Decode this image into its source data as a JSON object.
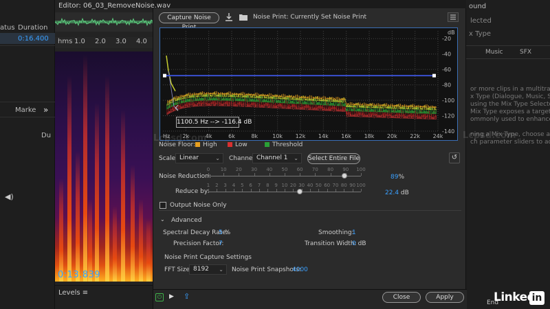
{
  "editor": {
    "title": "Editor: 06_03_RemoveNoise.wav",
    "ruler": [
      "hms",
      "1.0",
      "2.0",
      "3.0",
      "4.0"
    ],
    "time": "0:13.839",
    "levels_label": "Levels"
  },
  "files_panel": {
    "status_col": "atus",
    "duration_col": "Duration",
    "duration_value": "0:16.400",
    "markers_label": "Marke",
    "du_label": "Du"
  },
  "right_panel": {
    "title": "ound",
    "selected": "lected",
    "mix_type": "x Type",
    "tabs": [
      "Music",
      "SFX"
    ],
    "help_text": "or more clips in a multitrack se\nx Type (Dialogue, Music, Soun\nusing the Mix Type Selector al\nMix Type exposes a targeted\nommonly used to enhance that\n\nning a Mix Type, choose a pre\nch parameter sliders to adjust",
    "end_label": "End"
  },
  "dialog": {
    "capture_button": "Capture Noise Print",
    "noise_print_label": "Noise Print: Currently Set Noise Print",
    "cursor_readout": "1100.5 Hz --> -116.4 dB",
    "legend": {
      "title": "Noise Floor:",
      "high": "High",
      "low": "Low",
      "threshold": "Threshold",
      "high_color": "#e8a020",
      "low_color": "#d83030",
      "threshold_color": "#2aa035"
    },
    "scale_label": "Scale:",
    "scale_value": "Linear",
    "channel_label": "Channel:",
    "channel_value": "Channel 1",
    "select_entire_button": "Select Entire File",
    "noise_reduction_label": "Noise Reduction:",
    "noise_reduction_value": "89",
    "noise_reduction_unit": "%",
    "noise_reduction_ticks": [
      "0",
      "10",
      "20",
      "30",
      "40",
      "50",
      "60",
      "70",
      "80",
      "90",
      "100"
    ],
    "noise_reduction_fraction": 0.89,
    "reduce_by_label": "Reduce by:",
    "reduce_by_value": "22.4",
    "reduce_by_unit": "dB",
    "reduce_by_ticks": [
      "1",
      "2",
      "3",
      "4",
      "5",
      "6",
      "7",
      "8",
      "9",
      "10",
      "20",
      "30",
      "40",
      "50",
      "60",
      "70",
      "80",
      "90",
      "100"
    ],
    "reduce_by_fraction": 0.6,
    "output_noise_only": "Output Noise Only",
    "advanced_label": "Advanced",
    "spectral_decay_label": "Spectral Decay Rate:",
    "spectral_decay_value": "5",
    "spectral_decay_unit": "%",
    "smoothing_label": "Smoothing:",
    "smoothing_value": "1",
    "precision_label": "Precision Factor:",
    "precision_value": "7",
    "transition_label": "Transition Width:",
    "transition_value": "0",
    "transition_unit": "dB",
    "capture_settings_label": "Noise Print Capture Settings",
    "fft_label": "FFT Size:",
    "fft_value": "8192",
    "snapshots_label": "Noise Print Snapshots:",
    "snapshots_value": "4000",
    "close_button": "Close",
    "apply_button": "Apply"
  },
  "graph": {
    "db_unit": "dB",
    "db_ticks": [
      "-20",
      "-40",
      "-60",
      "-80",
      "-100",
      "-120",
      "-140"
    ],
    "hz_ticks": [
      "Hz",
      "2k",
      "4k",
      "6k",
      "8k",
      "10k",
      "12k",
      "14k",
      "16k",
      "18k",
      "20k",
      "22k",
      "24k"
    ],
    "threshold_db": -68,
    "accent": "#3a6fb7"
  },
  "watermarks": [
    "Lcpsd.com",
    "Lcpsd.com"
  ],
  "logo": "Linked"
}
